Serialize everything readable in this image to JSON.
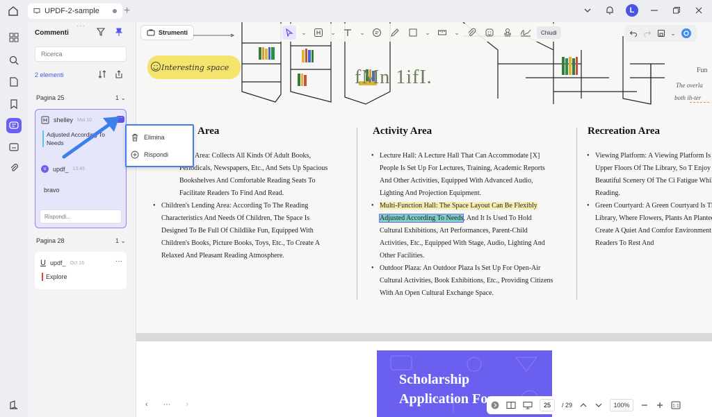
{
  "tab": {
    "title": "UPDF-2-sample"
  },
  "user": {
    "initial": "L"
  },
  "panel": {
    "title": "Commenti",
    "search_placeholder": "Ricerca",
    "count": "2 elementi",
    "groups": [
      {
        "page": "Pagina 25",
        "count": "1",
        "comment": {
          "author": "shelley",
          "date": "Mai 10",
          "text": "Adjusted According To Needs",
          "reply_author": "updf_",
          "reply_time": "13:46",
          "reply_text": "bravo",
          "reply_placeholder": "Rispondi..."
        }
      },
      {
        "page": "Pagina 28",
        "count": "1",
        "comment": {
          "author": "updf_",
          "date": "Oct 16",
          "text": "Explore"
        }
      }
    ]
  },
  "context_menu": {
    "delete": "Elimina",
    "reply": "Rispondi"
  },
  "toolbar": {
    "tools_label": "Strumenti",
    "close_label": "Chiudi"
  },
  "document": {
    "sticker": "Interesting space",
    "big_text": "fMn 1ifI.",
    "side_right_1": "Fun",
    "side_right_2": "The overla",
    "side_right_3": "both ih-ter",
    "col1_title": "Area",
    "col1_items": [
      "…ng Area: Collects All Kinds Of Adult Books, Periodicals, Newspapers, Etc., And Sets Up Spacious Bookshelves And Comfortable Reading Seats To Facilitate Readers To Find And Read.",
      "Children's Lending Area: According To The Reading Characteristics And Needs Of Children, The Space Is Designed To Be Full Of Childlike Fun, Equipped With Children's Books, Picture Books, Toys, Etc., To Create A Relaxed And Pleasant Reading Atmosphere."
    ],
    "col2_title": "Activity Area",
    "col2_item1": "Lecture Hall: A Lecture Hall That Can Accommodate [X] People Is Set Up For Lectures, Training, Academic Reports And Other Activities, Equipped With Advanced Audio, Lighting And Projection Equipment.",
    "col2_item2_hl": "Multi-Function Hall: The Space Layout Can Be Flexibly",
    "col2_item2_teal": "Adjusted According To Needs",
    "col2_item2_rest": ", And It Is Used To Hold Cultural Exhibitions, Art Performances, Parent-Child Activities, Etc., Equipped With Stage, Audio, Lighting And Other Facilities.",
    "col2_item3": "Outdoor Plaza: An Outdoor Plaza Is Set Up For Open-Air Cultural Activities, Book Exhibitions, Etc., Providing Citizens With An Open Cultural Exchange Space.",
    "col3_title": "Recreation Area",
    "col3_items": [
      "Viewing Platform: A Viewing Platform Is The Upper Floors Of The Library, So T Enjoy The Beautiful Scenery Of The Ci Fatigue While Reading.",
      "Green Courtyard: A Green Courtyard Is The Library, Where Flowers, Plants An Planted To Create A Quiet And Comfor Environment For Readers To Rest And"
    ],
    "scholarship_1": "Scholarship",
    "scholarship_2": "Application Form"
  },
  "bottom": {
    "dots": "···",
    "page_current": "25",
    "page_total": "/ 29",
    "zoom": "100%"
  },
  "colors": {
    "accent": "#6d5ef5",
    "highlight_blue": "#3f7fea",
    "highlight_yellow": "#f7eeb0",
    "highlight_teal": "#7dcfc7"
  }
}
